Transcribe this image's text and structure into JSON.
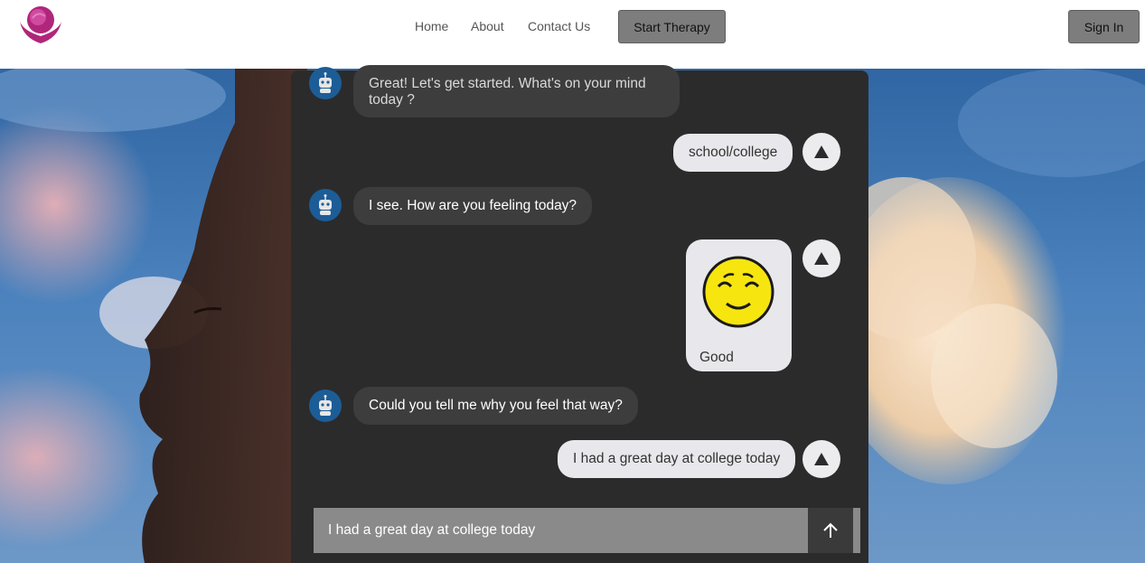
{
  "nav": {
    "logo_icon": "head-in-hands-logo",
    "links": [
      "Home",
      "About",
      "Contact Us"
    ],
    "start_therapy_label": "Start Therapy",
    "sign_in_label": "Sign In"
  },
  "chat": {
    "messages": [
      {
        "sender": "bot",
        "text": "Great! Let's get started. What's on your mind today ?"
      },
      {
        "sender": "user",
        "text": "school/college"
      },
      {
        "sender": "bot",
        "text": "I see. How are you feeling today?"
      },
      {
        "sender": "user",
        "type": "mood",
        "emoji": "relieved-face",
        "text": "Good"
      },
      {
        "sender": "bot",
        "text": "Could you tell me why you feel that way?"
      },
      {
        "sender": "user",
        "text": "I had a great day at college today"
      }
    ],
    "composer": {
      "value": "I had a great day at college today"
    },
    "send_icon": "arrow-up-icon",
    "bot_avatar_icon": "robot-icon",
    "user_avatar_icon": "triangle-up-icon"
  },
  "colors": {
    "brand": "#b0267a",
    "button_bg": "#7d7d7d",
    "chat_bg": "#2b2b2c",
    "bot_bubble": "#3d3d3e",
    "user_bubble": "#e8e8ec",
    "bot_avatar": "#1c5d97",
    "composer_bg": "#8a8a8a",
    "emoji_yellow": "#f7e50f"
  }
}
